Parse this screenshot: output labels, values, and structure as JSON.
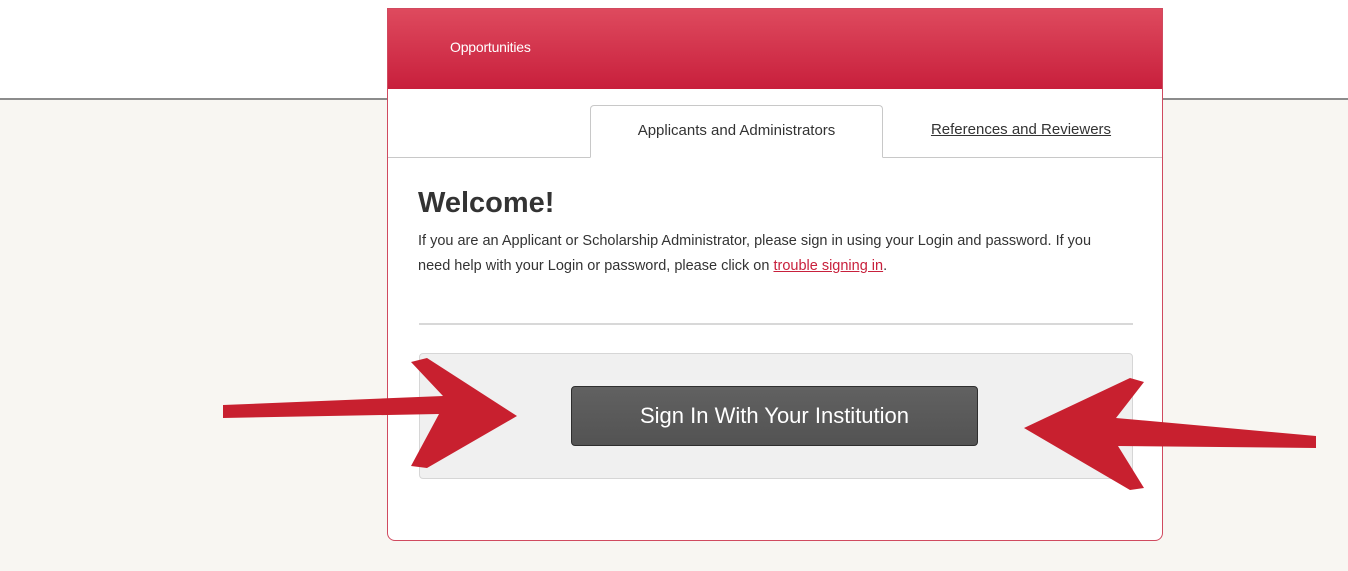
{
  "header": {
    "nav_link": "Opportunities"
  },
  "tabs": {
    "active": "Applicants and Administrators",
    "other": "References and Reviewers"
  },
  "content": {
    "heading": "Welcome!",
    "intro_prefix": "If you are an Applicant or Scholarship Administrator, please sign in using your Login and password. If you need help with your Login or password, please click on ",
    "intro_link": "trouble signing in",
    "intro_suffix": "."
  },
  "signin": {
    "button_label": "Sign In With Your Institution"
  },
  "colors": {
    "header_red": "#c81f3c",
    "link_red": "#c8203c",
    "arrow_red": "#c8202f",
    "button_dark": "#5a5a5a"
  }
}
